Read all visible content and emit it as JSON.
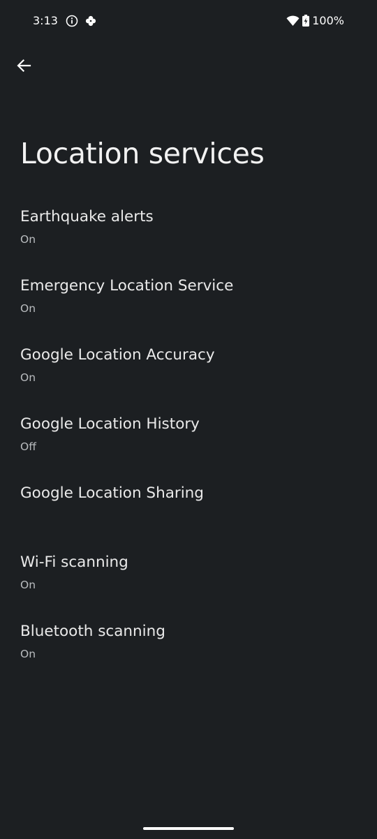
{
  "status_bar": {
    "time": "3:13",
    "left_icons": [
      "info-icon",
      "pinwheel-icon"
    ],
    "right_icons": [
      "wifi-icon",
      "battery-charging-icon"
    ],
    "battery_text": "100%"
  },
  "header": {
    "back_icon": "arrow-back-icon",
    "title": "Location services"
  },
  "settings": [
    {
      "title": "Earthquake alerts",
      "summary": "On"
    },
    {
      "title": "Emergency Location Service",
      "summary": "On"
    },
    {
      "title": "Google Location Accuracy",
      "summary": "On"
    },
    {
      "title": "Google Location History",
      "summary": "Off"
    },
    {
      "title": "Google Location Sharing",
      "summary": ""
    },
    {
      "title": "Wi-Fi scanning",
      "summary": "On"
    },
    {
      "title": "Bluetooth scanning",
      "summary": "On"
    }
  ],
  "colors": {
    "background": "#1c1f22",
    "text_primary": "#eaeaea",
    "text_secondary": "#b9bcbf"
  }
}
